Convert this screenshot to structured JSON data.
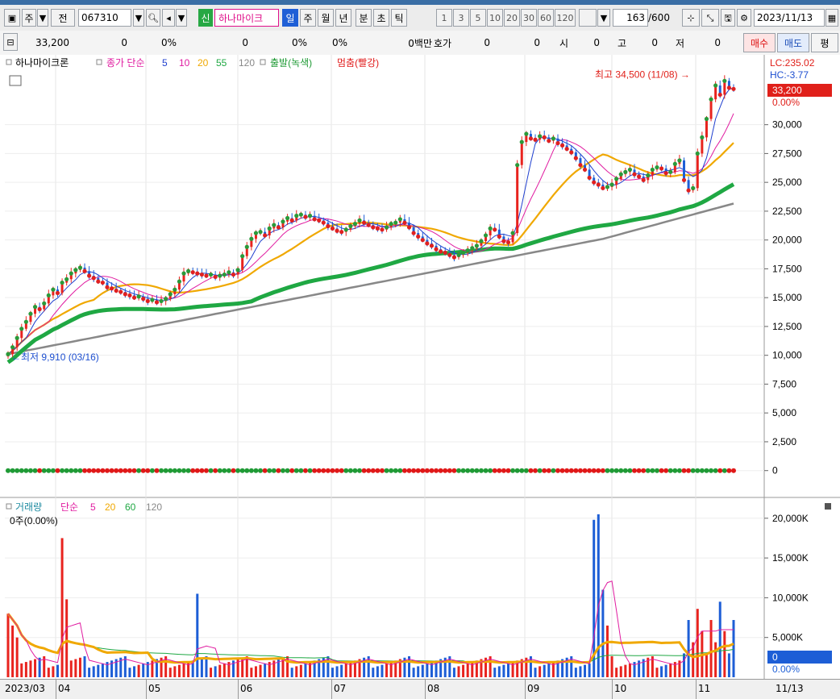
{
  "toolbar": {
    "period": "주",
    "adj": "전",
    "code": "067310",
    "new_badge": "신",
    "stock_name": "하나마이크",
    "period_buttons": [
      "일",
      "주",
      "월",
      "년",
      "분",
      "초",
      "틱"
    ],
    "active_period": "일",
    "interval_buttons": [
      "1",
      "3",
      "5",
      "10",
      "20",
      "30",
      "60",
      "120"
    ],
    "count": "163",
    "count_total": "/600",
    "date": "2023/11/13"
  },
  "quote": {
    "price": "33,200",
    "change": "0",
    "change_pct": "0%",
    "volume": "0",
    "vol_pct": "0%",
    "vol_pct2": "0%",
    "amount": "0백만",
    "hoga_label": "호가",
    "hoga1": "0",
    "hoga2": "0",
    "open_label": "시",
    "open": "0",
    "high_label": "고",
    "high": "0",
    "low_label": "저",
    "low": "0",
    "buy": "매수",
    "sell": "매도",
    "extra": "평"
  },
  "colors": {
    "up": "#e8231e",
    "down": "#1d5ed6",
    "ma5": "#1f3fcf",
    "ma10": "#e01ba0",
    "ma20": "#f0a800",
    "ma55": "#1fa843",
    "ma120": "#888888",
    "vma5": "#e01ba0",
    "vma20": "#f0a800",
    "vma60": "#1fa843"
  },
  "chart_data": {
    "type": "candlestick",
    "legend": {
      "name": "하나마이크론",
      "close_label": "종가 단순",
      "ma_periods": [
        "5",
        "10",
        "20",
        "55",
        "120"
      ],
      "signal_label1": "출발(녹색)",
      "signal_label2": "멈춤(빨강)"
    },
    "lc_label": "LC:235.02",
    "hc_label": "HC:-3.77",
    "last_price_label": "33,200",
    "last_pct_label": "0.00%",
    "high_annotation": "최고 34,500 (11/08) →",
    "low_annotation": "←최저 9,910 (03/16)",
    "yticks": [
      "30,000",
      "27,500",
      "25,000",
      "22,500",
      "20,000",
      "17,500",
      "15,000",
      "12,500",
      "10,000",
      "7,500",
      "5,000",
      "2,500",
      "0"
    ],
    "ylim": [
      -1000,
      35500
    ],
    "xlabels": [
      "2023/03",
      "04",
      "05",
      "06",
      "07",
      "08",
      "09",
      "10",
      "11"
    ],
    "xlabel_right": "11/13",
    "price_path_months": [
      {
        "m": "2023/03",
        "closes": [
          10100,
          10700,
          11500,
          12300,
          12900,
          13600,
          14200,
          14000,
          14500,
          15200,
          15700,
          15400,
          16300,
          16600
        ]
      },
      {
        "m": "04",
        "closes": [
          17100,
          17400,
          17600,
          17300,
          16900,
          16700,
          16400,
          16300,
          15900,
          15800,
          15600,
          15500,
          15300,
          15200,
          15000,
          15100,
          14900,
          14700,
          14800,
          14600
        ]
      },
      {
        "m": "05",
        "closes": [
          14700,
          14900,
          15300,
          15700,
          16400,
          17100,
          17300,
          17200,
          17100,
          17000,
          16900,
          17000,
          16800,
          16900,
          17000,
          17200,
          17000,
          17400,
          18600,
          19400,
          20100
        ]
      },
      {
        "m": "06",
        "closes": [
          20600,
          20700,
          20400,
          21000,
          21300,
          21100,
          21600,
          21900,
          21700,
          22100,
          22200,
          22000,
          22100,
          21800,
          21700,
          21500,
          21200,
          21000
        ]
      },
      {
        "m": "07",
        "closes": [
          20800,
          20700,
          20900,
          21200,
          21400,
          21700,
          21500,
          21300,
          21100,
          21000,
          20900,
          21100,
          21400,
          21500,
          21800,
          21500,
          21100,
          20600,
          20300,
          20000
        ]
      },
      {
        "m": "08",
        "closes": [
          19700,
          19500,
          19200,
          19000,
          18900,
          18700,
          18500,
          18700,
          18900,
          19100,
          19300,
          19500,
          19900,
          20400,
          21000,
          20900,
          20300,
          19900,
          19800,
          20600
        ]
      },
      {
        "m": "09",
        "closes": [
          26500,
          28500,
          29200,
          28800,
          28700,
          29000,
          28900,
          28600,
          28800,
          28400,
          28200,
          27900,
          27600,
          27100,
          26500,
          26100,
          25400,
          25000,
          24800,
          24500
        ]
      },
      {
        "m": "10",
        "closes": [
          24600,
          24800,
          25300,
          25700,
          25900,
          26100,
          25700,
          25500,
          25200,
          25600,
          26100,
          26300,
          26200,
          25800,
          25900,
          26600,
          26900,
          25200,
          24300,
          24500
        ]
      },
      {
        "m": "11",
        "closes": [
          27500,
          28900,
          30500,
          32200,
          33400,
          32600,
          33800,
          33200,
          33100
        ]
      }
    ],
    "volume_panel": {
      "title": "거래량",
      "ma_label": "단순",
      "ma_periods": [
        "5",
        "20",
        "60",
        "120"
      ],
      "status": "0주(0.00%)",
      "yticks": [
        "20,000K",
        "15,000K",
        "10,000K",
        "5,000K"
      ],
      "last_label": "0",
      "last_pct": "0.00%",
      "ylim_k": [
        0,
        21500
      ]
    }
  }
}
